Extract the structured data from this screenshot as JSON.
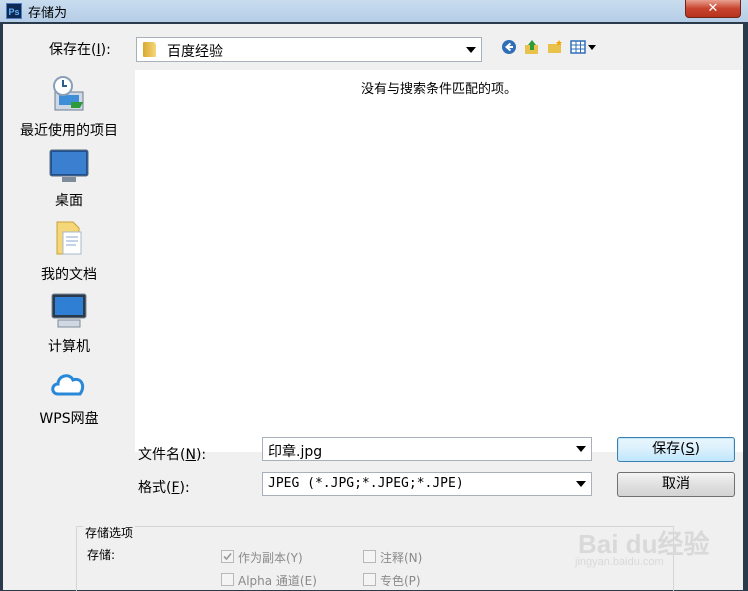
{
  "window": {
    "app_icon": "Ps",
    "title": "存储为",
    "close_glyph": "✕"
  },
  "location": {
    "label_pre": "保存在(",
    "label_key": "I",
    "label_post": "):",
    "current_folder": "百度经验"
  },
  "toolbar_icons": [
    "back-icon",
    "up-folder-icon",
    "new-folder-icon",
    "view-menu-icon"
  ],
  "places": [
    {
      "name": "recent",
      "label": "最近使用的项目",
      "icon": "recent-items-icon"
    },
    {
      "name": "desktop",
      "label": "桌面",
      "icon": "desktop-icon"
    },
    {
      "name": "documents",
      "label": "我的文档",
      "icon": "documents-icon"
    },
    {
      "name": "computer",
      "label": "计算机",
      "icon": "computer-icon"
    },
    {
      "name": "wps-cloud",
      "label": "WPS网盘",
      "icon": "cloud-icon"
    }
  ],
  "file_list": {
    "empty_message": "没有与搜索条件匹配的项。"
  },
  "filename": {
    "label_pre": "文件名(",
    "label_key": "N",
    "label_post": "):",
    "value": "印章.jpg"
  },
  "format": {
    "label_pre": "格式(",
    "label_key": "F",
    "label_post": "):",
    "value": "JPEG (*.JPG;*.JPEG;*.JPE)"
  },
  "buttons": {
    "save_pre": "保存(",
    "save_key": "S",
    "save_post": ")",
    "cancel": "取消"
  },
  "save_options": {
    "group_title": "存储选项",
    "save_label": "存储:",
    "as_copy": "作为副本(Y)",
    "notes": "注释(N)",
    "alpha": "Alpha 通道(E)",
    "spot": "专色(P)"
  },
  "watermark": {
    "brand": "Bai du经验",
    "url": "jingyan.baidu.com"
  },
  "colors": {
    "accent": "#3c7fb1",
    "close_button": "#c8442f",
    "titlebar": "#c9dcef"
  }
}
